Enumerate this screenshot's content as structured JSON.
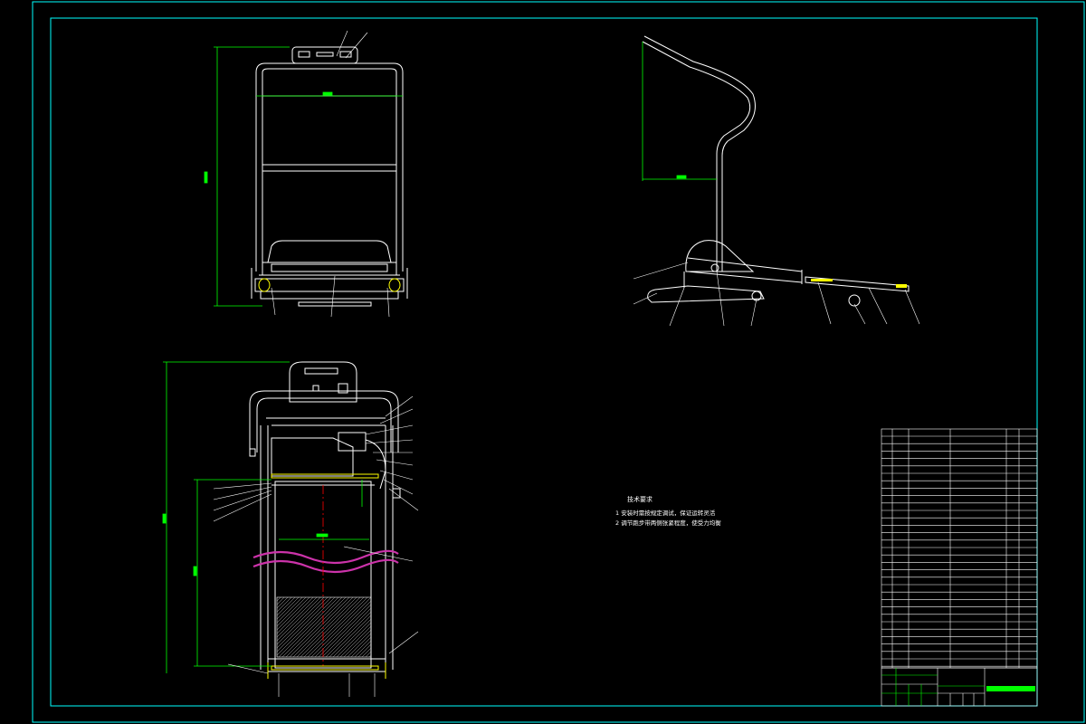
{
  "drawing": {
    "tech_notes_title": "技术要求",
    "tech_notes": [
      "1  安装时需按规定调试，保证运转灵活",
      "2  调节跑步带两侧张紧程度，使受力均衡"
    ],
    "colors": {
      "background": "#000000",
      "border": "#00ffff",
      "lines": "#ffffff",
      "dimensions": "#00ff00",
      "centerline": "#ff0000",
      "belt_wave": "#cc33aa",
      "accent": "#ffff00"
    }
  }
}
